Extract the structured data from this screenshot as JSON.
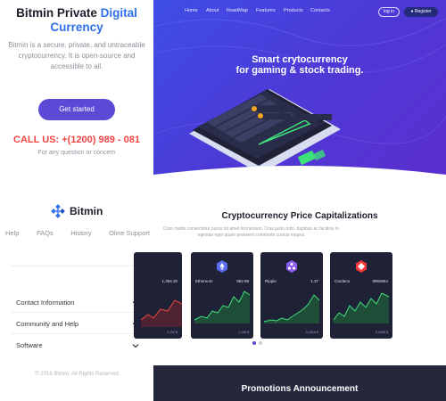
{
  "left": {
    "title_main": "Bitmin Private",
    "title_accent": "Digital Currency",
    "description": "Bitmin is a secure, private, and untraceable cryptocurrency. It is open-source and accessible to all.",
    "cta": "Get started",
    "call": "CALL US: +(1200) 989 - 081",
    "call_sub": "For any question or concern",
    "brand": "Bitmin",
    "links": [
      "Help",
      "FAQs",
      "History",
      "Oline Support"
    ],
    "accordion": [
      "Contact Information",
      "Community and Help",
      "Software"
    ],
    "copyright": "© 2018 Bitmin. All Rights Reserved"
  },
  "nav": {
    "items": [
      "Home",
      "About",
      "RoadMap",
      "Features",
      "Products",
      "Contacts"
    ],
    "login": "log in",
    "register": "Register"
  },
  "hero": {
    "line1": "Smart crytocurrency",
    "line2": "for gaming & stock trading."
  },
  "section": {
    "title": "Cryptocurrency Price Capitalizations",
    "description": "Cras mattis consectetur purus sit amet fermentum. Cras justo odio, dapibus ac facilisis in, egestas eget quam praesent commodo cursus magna."
  },
  "cards": [
    {
      "name": "",
      "price": "1,354.30",
      "color": "#f04a3a",
      "foot": [
        "",
        "2,152 $"
      ]
    },
    {
      "name": "Ethereum",
      "price": "982.99",
      "color": "#5b6cf0",
      "foot": [
        "",
        "1,156 $"
      ]
    },
    {
      "name": "Ripple",
      "price": "1.37",
      "color": "#8a5cf0",
      "foot": [
        "",
        "0,1516 $"
      ]
    },
    {
      "name": "Cardano",
      "price": "8955864",
      "color": "#f03a3a",
      "foot": [
        "",
        "0,0456 $"
      ]
    }
  ],
  "promo": {
    "title": "Promotions Announcement"
  },
  "colors": {
    "accent": "#2f6fe8",
    "button": "#5a4ad6",
    "call": "#f04444",
    "hero_start": "#3e4ee6",
    "hero_end": "#5b2fcf"
  }
}
